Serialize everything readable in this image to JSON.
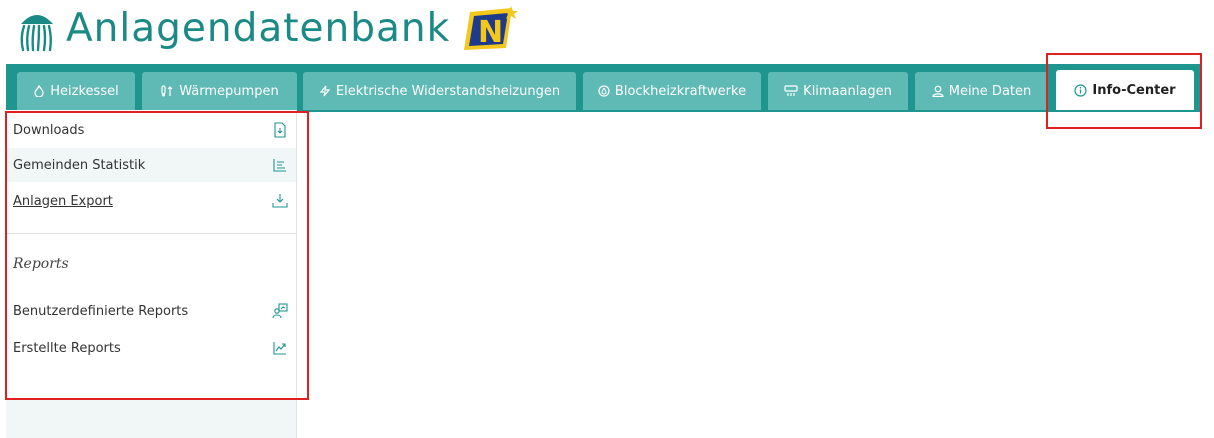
{
  "header": {
    "app_title": "Anlagendatenbank",
    "logo_icon": "jellyfish-logo-icon",
    "brand_icon": "noe-brand-logo"
  },
  "tabs": [
    {
      "label": "Heizkessel",
      "icon": "flame-icon"
    },
    {
      "label": "Wärmepumpen",
      "icon": "thermometer-arrows-icon"
    },
    {
      "label": "Elektrische Widerstandsheizungen",
      "icon": "lightning-icon"
    },
    {
      "label": "Blockheizkraftwerke",
      "icon": "power-plant-icon"
    },
    {
      "label": "Klimaanlagen",
      "icon": "air-conditioner-icon"
    },
    {
      "label": "Meine Daten",
      "icon": "user-icon"
    },
    {
      "label": "Info-Center",
      "icon": "info-icon",
      "active": true
    }
  ],
  "sidebar": {
    "items": [
      {
        "label": "Downloads",
        "icon": "file-download-icon"
      },
      {
        "label": "Gemeinden Statistik",
        "icon": "statistics-list-icon"
      },
      {
        "label": "Anlagen Export",
        "icon": "export-download-icon"
      }
    ],
    "reports_heading": "Reports",
    "report_items": [
      {
        "label": "Benutzerdefinierte Reports",
        "icon": "user-report-icon"
      },
      {
        "label": "Erstellte Reports",
        "icon": "trend-chart-icon"
      }
    ]
  },
  "colors": {
    "accent": "#1f9590",
    "tab_inactive": "#5fbab5",
    "title": "#1b8a86",
    "highlight": "#e02020"
  }
}
